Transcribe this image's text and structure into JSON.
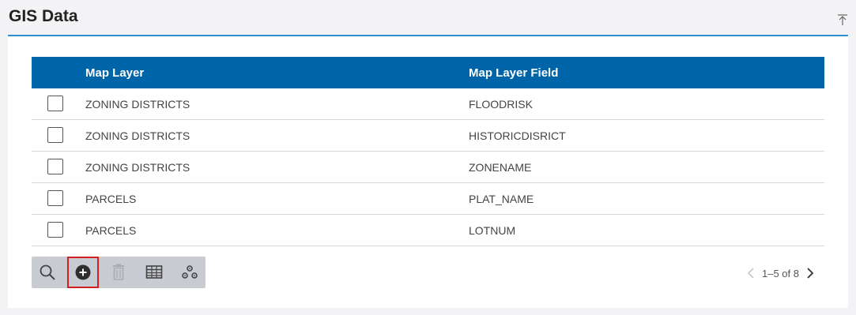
{
  "header": {
    "title": "GIS Data",
    "collapse_icon": "collapse-up-icon"
  },
  "table": {
    "columns": [
      "Map Layer",
      "Map Layer Field"
    ],
    "rows": [
      {
        "layer": "ZONING DISTRICTS",
        "field": "FLOODRISK"
      },
      {
        "layer": "ZONING DISTRICTS",
        "field": "HISTORICDISRICT"
      },
      {
        "layer": "ZONING DISTRICTS",
        "field": "ZONENAME"
      },
      {
        "layer": "PARCELS",
        "field": "PLAT_NAME"
      },
      {
        "layer": "PARCELS",
        "field": "LOTNUM"
      }
    ]
  },
  "toolbar": {
    "items": [
      {
        "icon": "search-icon",
        "enabled": true
      },
      {
        "icon": "add-circle-icon",
        "enabled": true,
        "selected": true
      },
      {
        "icon": "trash-icon",
        "enabled": false
      },
      {
        "icon": "table-grid-icon",
        "enabled": true
      },
      {
        "icon": "gears-icon",
        "enabled": true
      }
    ]
  },
  "pager": {
    "range": "1–5 of 8"
  },
  "colors": {
    "header_bg": "#0064a8",
    "accent_line": "#2f8fcf",
    "toolbar_bg": "#c8cbd1",
    "selected_outline": "#d21f1f"
  }
}
